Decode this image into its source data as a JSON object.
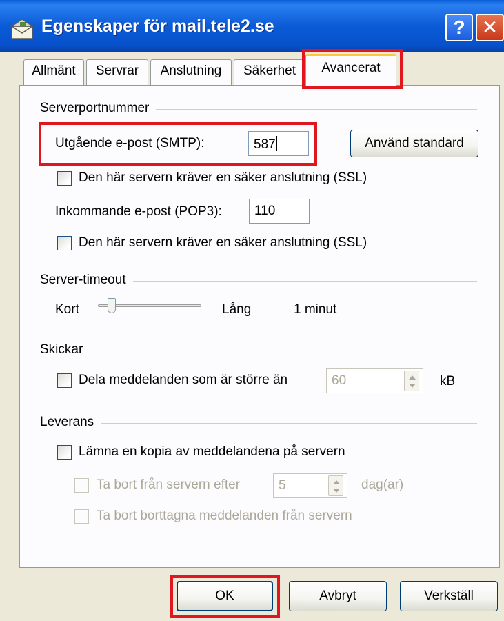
{
  "window": {
    "title": "Egenskaper för mail.tele2.se",
    "help_label": "?",
    "close_label": "✕"
  },
  "tabs": [
    {
      "label": "Allmänt"
    },
    {
      "label": "Servrar"
    },
    {
      "label": "Anslutning"
    },
    {
      "label": "Säkerhet"
    },
    {
      "label": "Avancerat",
      "active": true
    }
  ],
  "server_ports": {
    "heading": "Serverportnummer",
    "smtp_label": "Utgående e-post (SMTP):",
    "smtp_value": "587",
    "use_default_label": "Använd standard",
    "smtp_ssl_label": "Den här servern kräver en säker anslutning (SSL)",
    "pop3_label": "Inkommande e-post (POP3):",
    "pop3_value": "110",
    "pop3_ssl_label": "Den här servern kräver en säker anslutning (SSL)"
  },
  "timeout": {
    "heading": "Server-timeout",
    "short_label": "Kort",
    "long_label": "Lång",
    "value_label": "1 minut",
    "slider_level": 0.1
  },
  "sending": {
    "heading": "Skickar",
    "split_label": "Dela meddelanden som är större än",
    "split_value": "60",
    "unit": "kB"
  },
  "delivery": {
    "heading": "Leverans",
    "keep_copy_label": "Lämna en kopia av meddelandena på servern",
    "remove_after_label": "Ta bort från servern efter",
    "remove_after_value": "5",
    "remove_after_unit": "dag(ar)",
    "remove_deleted_label": "Ta bort borttagna meddelanden från servern"
  },
  "buttons": {
    "ok": "OK",
    "cancel": "Avbryt",
    "apply": "Verkställ"
  },
  "colors": {
    "titlebar": "#0b5ad6",
    "highlight": "#e0171f",
    "active_tab_accent": "#ffc83c"
  }
}
